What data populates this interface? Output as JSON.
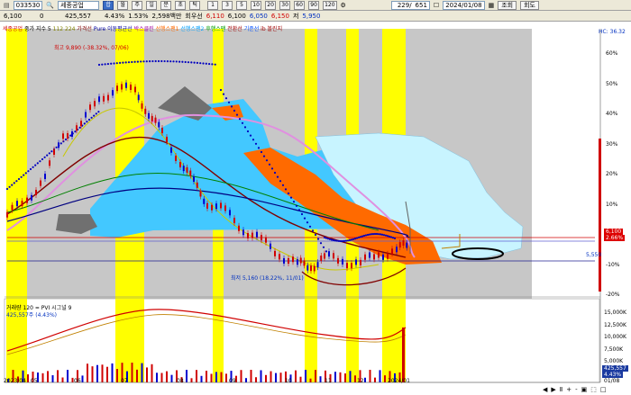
{
  "toolbar1": {
    "code": "033530",
    "stock_name": "세종공업",
    "btn_sum": "합",
    "btn_month": "월",
    "btn_week": "주",
    "btn_day": "일",
    "btn_min": "분",
    "btn_tick": "초",
    "btn_hour": "틱",
    "intervals": [
      "1",
      "3",
      "5",
      "10",
      "20",
      "30",
      "60",
      "90",
      "120"
    ],
    "count": "229",
    "total": "651",
    "date": "2024/01/08",
    "btn_query": "조회",
    "btn_reset": "회도"
  },
  "toolbar2": {
    "price": "6,100",
    "change": "0",
    "volume": "425,557",
    "rate": "4.43%",
    "ratio": "1.53%",
    "amount": "2,598백만",
    "info1": "회우선",
    "open": "6,110",
    "high": "6,100",
    "low": "6,050",
    "prev": "6,150",
    "label_prev": "저",
    "close": "5,950"
  },
  "legend_top": {
    "name": "세종공업",
    "items": [
      "중가 지수 5",
      "112 224",
      "가격선",
      "Pure 이동평균선",
      "박스클린",
      "선행스팬1",
      "선행스팬2",
      "후행스팬",
      "전환선",
      "기준선",
      "ib 볼린지"
    ]
  },
  "annotations": {
    "high_label": "최고 9,890 (-38.32%, 07/06)",
    "low_label": "최저 5,160 (18.22%, 11/01)",
    "price_marker": "5,550",
    "hc_label": "HC: 36.32"
  },
  "right_axis": {
    "pct_labels": [
      "60%",
      "50%",
      "40%",
      "30%",
      "20%",
      "10%",
      "0%",
      "-10%",
      "-20%"
    ],
    "vol_labels": [
      "15,000K",
      "12,500K",
      "10,000K",
      "7,500K",
      "5,000K",
      "2,500K"
    ],
    "current_box1": "6,100",
    "current_box2": "2.66%",
    "vol_box1": "425,557",
    "vol_box2": "4.43%"
  },
  "lower_legend": {
    "line1": "거래량 120 = PVI 시그널 9",
    "line2": "425,557주 (4.43%)"
  },
  "x_axis": {
    "labels": [
      "2023/04",
      "05",
      "06",
      "07",
      "08",
      "09",
      "10",
      "11",
      "12",
      "2024/01"
    ],
    "right_label": "01/08"
  },
  "bottom_controls": [
    "◀",
    "▶",
    "Ⅱ",
    "+",
    "-",
    "▣",
    "⬚",
    "□"
  ],
  "colors": {
    "yellow_band": "#ffff00",
    "gray_band": "#bdbdbd",
    "cloud_cyan": "#43c8ff",
    "cloud_orange": "#ff6a00",
    "cloud_lightcyan": "#c8f4ff",
    "dotted_blue": "#0000c0",
    "price_line": "#1010a0"
  }
}
